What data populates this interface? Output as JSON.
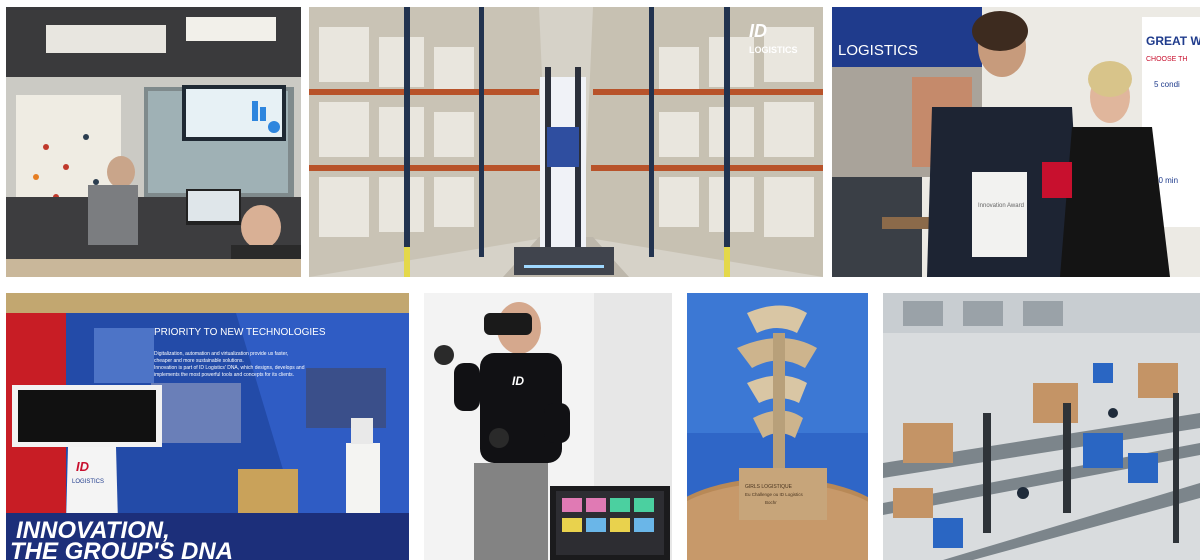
{
  "collage": {
    "tile_warehouse": {
      "logo_text": "ID",
      "logo_sub": "LOGISTICS"
    },
    "tile_award_ceremony": {
      "wall_text": "LOGISTICS",
      "screen_title": "GREAT W",
      "screen_line1": "CHOOSE TH",
      "screen_line2": "5 condi",
      "screen_line3": "60 min",
      "certificate_text": "Innovation Award"
    },
    "tile_showroom": {
      "panel_title": "PRIORITY TO NEW TECHNOLOGIES",
      "panel_body_1": "Digitalization, automation and virtualization provide us faster,",
      "panel_body_2": "cheaper and more sustainable solutions.",
      "panel_body_3": "Innovation is part of ID Logistics' DNA, which designs, develops and",
      "panel_body_4": "implements the most powerful tools and concepts for its clients.",
      "kiosk_logo": "ID",
      "kiosk_sub": "LOGISTICS",
      "floor_line1": "INNOVATION,",
      "floor_line2": "THE GROUP'S DNA"
    },
    "tile_vr": {
      "shirt_logo": "ID"
    },
    "tile_trophy": {
      "plaque_line1": "GIRLS LOGISTIQUE",
      "plaque_line2": "Eu Challenge ou ID Logistics",
      "plaque_line3": "Bochr"
    }
  },
  "colors": {
    "brand_blue": "#1f3b8c",
    "brand_red": "#c8102e",
    "sky": "#3b74c9"
  }
}
